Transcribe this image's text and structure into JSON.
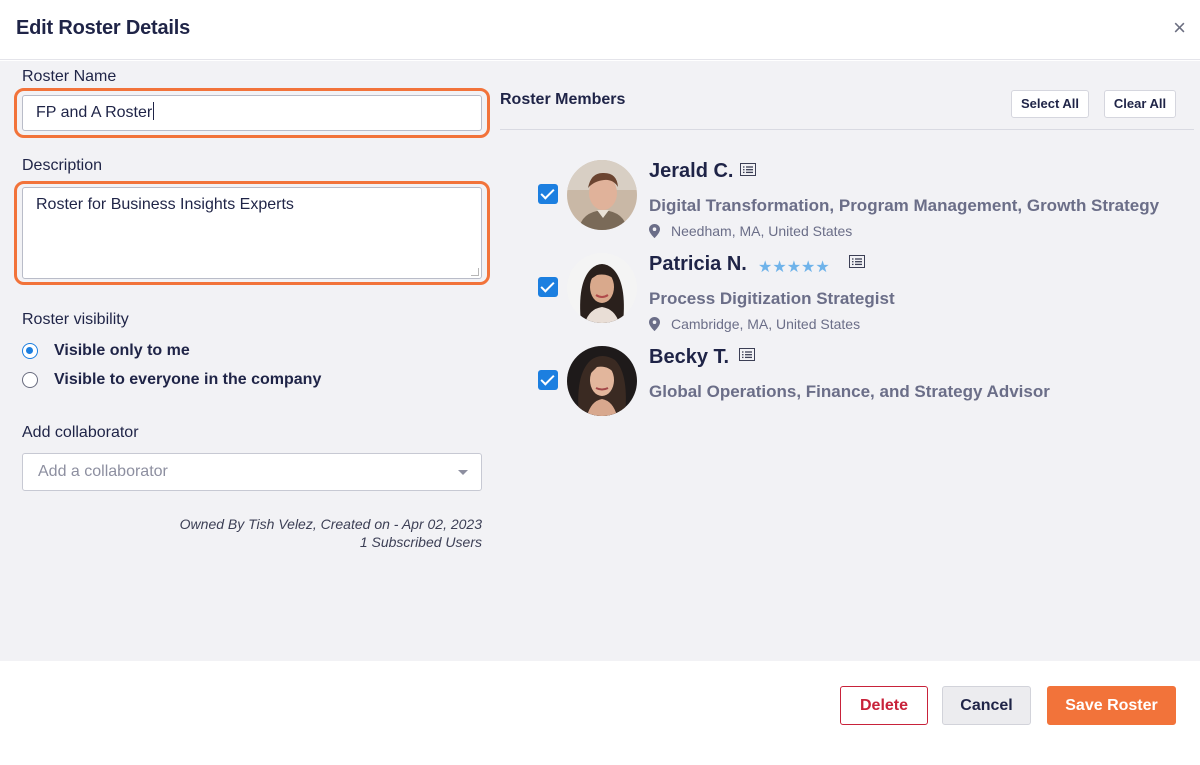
{
  "dialog": {
    "title": "Edit Roster Details",
    "close_glyph": "×"
  },
  "form": {
    "roster_name_label": "Roster Name",
    "roster_name_value": "FP and A Roster",
    "description_label": "Description",
    "description_value": "Roster for Business Insights Experts",
    "visibility_label": "Roster visibility",
    "visibility_options": [
      {
        "label": "Visible only to me",
        "selected": true
      },
      {
        "label": "Visible to everyone in the company",
        "selected": false
      }
    ],
    "collaborator_label": "Add collaborator",
    "collaborator_placeholder": "Add a collaborator",
    "owner_line": "Owned By Tish Velez, Created on - Apr 02, 2023",
    "subscribers_line": "1 Subscribed Users"
  },
  "members": {
    "title": "Roster Members",
    "select_all": "Select All",
    "clear_all": "Clear All",
    "list": [
      {
        "name": "Jerald C.",
        "title": "Digital Transformation, Program Management, Growth Strategy",
        "location": "Needham, MA, United States",
        "checked": true,
        "stars": ""
      },
      {
        "name": "Patricia N.",
        "title": "Process Digitization Strategist",
        "location": "Cambridge, MA, United States",
        "checked": true,
        "stars": "★★★★★"
      },
      {
        "name": "Becky T.",
        "title": "Global Operations, Finance, and Strategy Advisor",
        "location": "",
        "checked": true,
        "stars": ""
      }
    ]
  },
  "footer": {
    "delete": "Delete",
    "cancel": "Cancel",
    "save": "Save Roster"
  },
  "colors": {
    "accent_orange": "#f2733a",
    "check_blue": "#1c7fe0",
    "delete_red": "#c8223a",
    "star_blue": "#6fb3ea"
  }
}
